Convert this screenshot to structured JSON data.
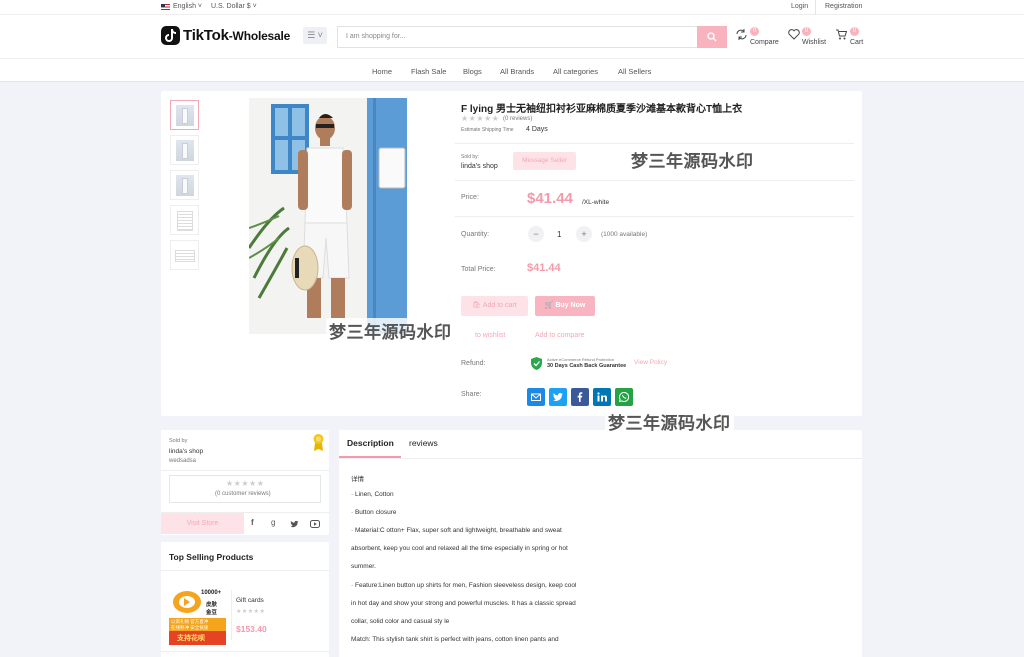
{
  "topbar": {
    "language": "English",
    "currency": "U.S. Dollar $",
    "login": "Login",
    "registration": "Registration"
  },
  "header": {
    "logo_main": "TikTok",
    "logo_sub": "-Wholesale",
    "search_placeholder": "I am shopping for...",
    "compare_label": "Compare",
    "compare_count": "0",
    "wishlist_label": "Wishlist",
    "wishlist_count": "0",
    "cart_label": "Cart",
    "cart_count": "0"
  },
  "nav": [
    "Home",
    "Flash Sale",
    "Blogs",
    "All Brands",
    "All categories",
    "All Sellers"
  ],
  "product": {
    "title": "F lying 男士无袖纽扣衬衫亚麻棉质夏季沙滩基本款背心T恤上衣",
    "reviews": "(0 reviews)",
    "shipping_label": "Estimate Shipping Time",
    "shipping_value": "4 Days",
    "sold_by_label": "Sold by:",
    "shop_name": "linda's shop",
    "message_seller": "Message Seller",
    "price_label": "Price:",
    "price": "$41.44",
    "variant": "/XL-white",
    "quantity_label": "Quantity:",
    "quantity": "1",
    "available": "(1000 available)",
    "total_label": "Total Price:",
    "total": "$41.44",
    "add_to_cart": "Add to cart",
    "buy_now": "Buy Now",
    "add_wishlist": "Add to wishlist",
    "add_wishlist_visible": "to wishlist",
    "add_compare": "Add to compare",
    "refund_label": "Refund:",
    "refund_small": "Active eCommerce Refund Protection",
    "refund_main": "30 Days Cash Back Guarantee",
    "view_policy": "View Policy",
    "share_label": "Share:"
  },
  "watermark": "梦三年源码水印",
  "seller": {
    "sold_by": "Sold by",
    "shop_name": "linda's shop",
    "shop_desc": "wedsadsa",
    "customer_reviews": "(0 customer reviews)",
    "visit_store": "Visit Store"
  },
  "top_selling": {
    "title": "Top Selling Products",
    "item_name": "Gift cards",
    "item_price": "$153.40",
    "img_text_top": "10000+",
    "img_text_mid1": "皮肤",
    "img_text_mid2": "金豆",
    "img_text_line1": "以资礼物 官方直冲",
    "img_text_line2": "在线秒冲 安全快速",
    "img_text_bottom": "支持花呗"
  },
  "tabs": {
    "description": "Description",
    "reviews": "reviews"
  },
  "description": [
    "详情",
    "· Linen, Cotton",
    "· Button closure",
    "· Material:C otton+ Flax, super soft and lightweight, breathable and sweat",
    "absorbent, keep you cool and relaxed all the time especially in spring or hot",
    "summer.",
    "·  Feature:Linen button up shirts for men, Fashion sleeveless design, keep cool",
    "in hot day and show your strong and powerful muscles. It has a classic spread",
    "collar, solid color and casual sty le",
    "Match: This stylish tank shirt is perfect with jeans, cotton linen pants and"
  ],
  "colors": {
    "accent": "#f49aaa",
    "accent_soft": "#fde3e8",
    "email": "#1e88e5",
    "twitter": "#1da1f2",
    "facebook": "#3b5998",
    "linkedin": "#0077b5",
    "whatsapp": "#25a244"
  }
}
